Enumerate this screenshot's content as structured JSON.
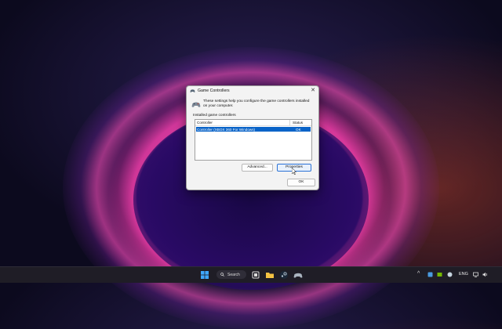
{
  "dialog": {
    "title": "Game Controllers",
    "close_glyph": "✕",
    "intro": "These settings help you configure the game controllers installed on your computer.",
    "group_label": "Installed game controllers",
    "columns": {
      "controller": "Controller",
      "status": "Status"
    },
    "rows": [
      {
        "controller": "Controller (XBOX 360 For Windows)",
        "status": "OK",
        "selected": true
      }
    ],
    "buttons": {
      "advanced": "Advanced...",
      "properties": "Properties",
      "ok": "OK"
    },
    "icon": "gamepad-icon"
  },
  "taskbar": {
    "search_label": "Search",
    "language": "ENG",
    "pinned": [
      "windows-start-icon",
      "search-icon",
      "task-view-icon",
      "file-explorer-icon",
      "steam-icon",
      "game-controller-icon"
    ],
    "tray": [
      "chevron-up-icon",
      "app-tray-icon",
      "nvidia-icon",
      "steam-tray-icon",
      "language-indicator",
      "network-icon",
      "volume-icon"
    ]
  },
  "colors": {
    "accent": "#0a64c8",
    "taskbar": "#1f1d26"
  }
}
